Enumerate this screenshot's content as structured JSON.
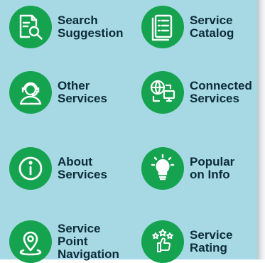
{
  "menu": [
    {
      "lines": [
        "Search",
        "Suggestion"
      ],
      "icon": "search-document-icon"
    },
    {
      "lines": [
        "Service",
        "Catalog"
      ],
      "icon": "catalog-icon"
    },
    {
      "lines": [
        "Other",
        "Services"
      ],
      "icon": "headset-agent-icon"
    },
    {
      "lines": [
        "Connected",
        "Services"
      ],
      "icon": "connected-globe-icon"
    },
    {
      "lines": [
        "About",
        "Services"
      ],
      "icon": "info-icon"
    },
    {
      "lines": [
        "Popular",
        "on Info"
      ],
      "icon": "lightbulb-icon"
    },
    {
      "lines": [
        "Service",
        "Point",
        "Navigation"
      ],
      "icon": "location-pin-icon"
    },
    {
      "lines": [
        "Service",
        "Rating"
      ],
      "icon": "thumbs-up-stars-icon"
    }
  ],
  "colors": {
    "panel": "#a6d9e4",
    "icon_bg": "#16a34f",
    "text": "#0c2b38"
  }
}
